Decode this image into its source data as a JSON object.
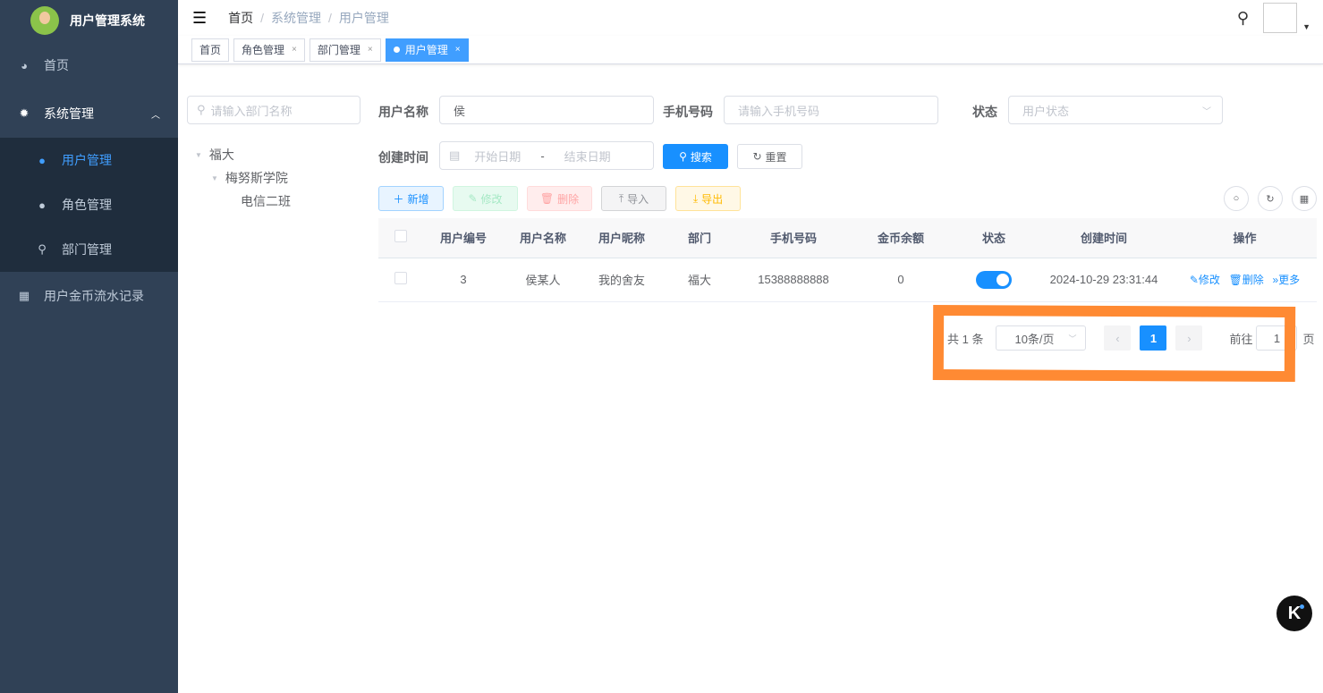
{
  "app": {
    "title": "用户管理系统"
  },
  "sidebar": {
    "items": [
      {
        "label": "首页",
        "icon": "dashboard-icon"
      },
      {
        "label": "系统管理",
        "icon": "gear-icon",
        "children": [
          {
            "label": "用户管理",
            "icon": "user-icon",
            "active": true
          },
          {
            "label": "角色管理",
            "icon": "users-icon"
          },
          {
            "label": "部门管理",
            "icon": "tree-icon"
          }
        ]
      },
      {
        "label": "用户金币流水记录",
        "icon": "table-icon"
      }
    ]
  },
  "breadcrumb": [
    "首页",
    "系统管理",
    "用户管理"
  ],
  "tags": [
    {
      "label": "首页"
    },
    {
      "label": "角色管理"
    },
    {
      "label": "部门管理"
    },
    {
      "label": "用户管理",
      "active": true
    }
  ],
  "tree": {
    "placeholder": "请输入部门名称",
    "nodes": [
      "福大",
      "梅努斯学院",
      "电信二班"
    ]
  },
  "search": {
    "username_label": "用户名称",
    "username_value": "侯",
    "phone_label": "手机号码",
    "phone_placeholder": "请输入手机号码",
    "status_label": "状态",
    "status_placeholder": "用户状态",
    "date_label": "创建时间",
    "start_placeholder": "开始日期",
    "date_sep": "-",
    "end_placeholder": "结束日期",
    "search_btn": "搜索",
    "reset_btn": "重置"
  },
  "toolbar": {
    "add": "新增",
    "edit": "修改",
    "delete": "删除",
    "import": "导入",
    "export": "导出"
  },
  "table": {
    "columns": [
      "用户编号",
      "用户名称",
      "用户昵称",
      "部门",
      "手机号码",
      "金币余额",
      "状态",
      "创建时间",
      "操作"
    ],
    "rows": [
      {
        "id": "3",
        "username": "侯某人",
        "nickname": "我的舍友",
        "dept": "福大",
        "phone": "15388888888",
        "coins": "0",
        "status_on": true,
        "created": "2024-10-29 23:31:44"
      }
    ],
    "actions": {
      "edit": "修改",
      "delete": "删除",
      "more": "更多"
    }
  },
  "pagination": {
    "total": "共 1 条",
    "page_size": "10条/页",
    "current": "1",
    "goto_label": "前往",
    "goto_value": "1",
    "page_suffix": "页"
  },
  "colors": {
    "primary": "#1890ff",
    "sidebar": "#304156",
    "highlight": "#ff8a33"
  }
}
